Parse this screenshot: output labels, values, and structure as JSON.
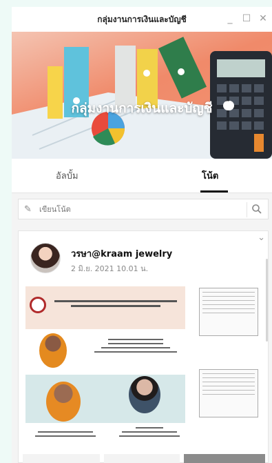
{
  "window": {
    "title": "กลุ่มงานการเงินและบัญชี",
    "controls": [
      "_",
      "☐",
      "✕"
    ]
  },
  "cover": {
    "title": "กลุ่มงานการเงินและบัญชี"
  },
  "tabs": {
    "album": "อัลบั้ม",
    "notes": "โน้ต"
  },
  "toolbar": {
    "write_note": "เขียนโน้ต"
  },
  "post": {
    "author": "วรษา@kraam jewelry",
    "time": "2 มิ.ย. 2021 10.01 น."
  },
  "colors": {
    "accent": "#111111",
    "cover": "#f08a6a",
    "background": "#eefaf7"
  }
}
